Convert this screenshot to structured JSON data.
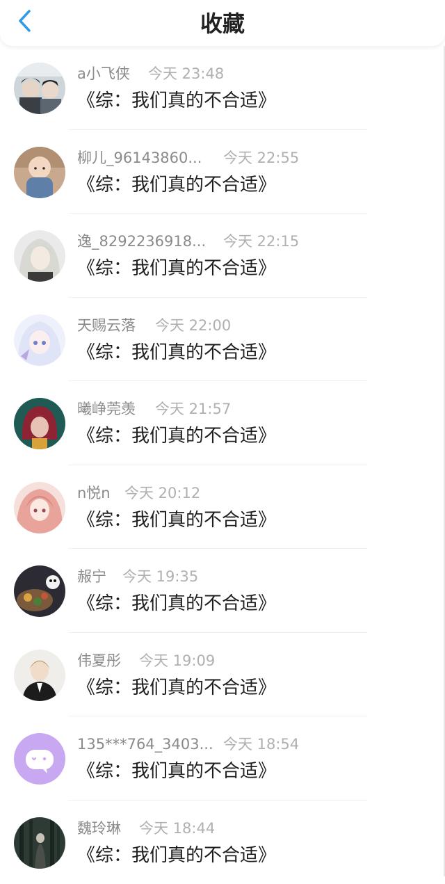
{
  "header": {
    "title": "收藏"
  },
  "colors": {
    "accent": "#2e9ae8"
  },
  "items": [
    {
      "name": "a小飞侠",
      "time": "今天 23:48",
      "title": "《综：我们真的不合适》",
      "avatar": "avatar-two-figures-icon"
    },
    {
      "name": "柳儿_96143860...",
      "time": "今天 22:55",
      "title": "《综：我们真的不合适》",
      "avatar": "avatar-baby-icon"
    },
    {
      "name": "逸_8292236918...",
      "time": "今天 22:15",
      "title": "《综：我们真的不合适》",
      "avatar": "avatar-white-hair-icon"
    },
    {
      "name": "天赐云落",
      "time": "今天 22:00",
      "title": "《综：我们真的不合适》",
      "avatar": "avatar-anime-girl-icon"
    },
    {
      "name": "曦峥莞羡",
      "time": "今天 21:57",
      "title": "《综：我们真的不合适》",
      "avatar": "avatar-red-hair-icon"
    },
    {
      "name": "n悦n",
      "time": "今天 20:12",
      "title": "《综：我们真的不合适》",
      "avatar": "avatar-pink-hair-icon"
    },
    {
      "name": "赧宁",
      "time": "今天 19:35",
      "title": "《综：我们真的不合适》",
      "avatar": "avatar-food-icon"
    },
    {
      "name": "伟夏彤",
      "time": "今天 19:09",
      "title": "《综：我们真的不合适》",
      "avatar": "avatar-suit-boy-icon"
    },
    {
      "name": "135***764_3403...",
      "time": "今天 18:54",
      "title": "《综：我们真的不合适》",
      "avatar": "avatar-chat-bubble-icon"
    },
    {
      "name": "魏玲琳",
      "time": "今天 18:44",
      "title": "《综：我们真的不合适》",
      "avatar": "avatar-forest-icon"
    }
  ]
}
